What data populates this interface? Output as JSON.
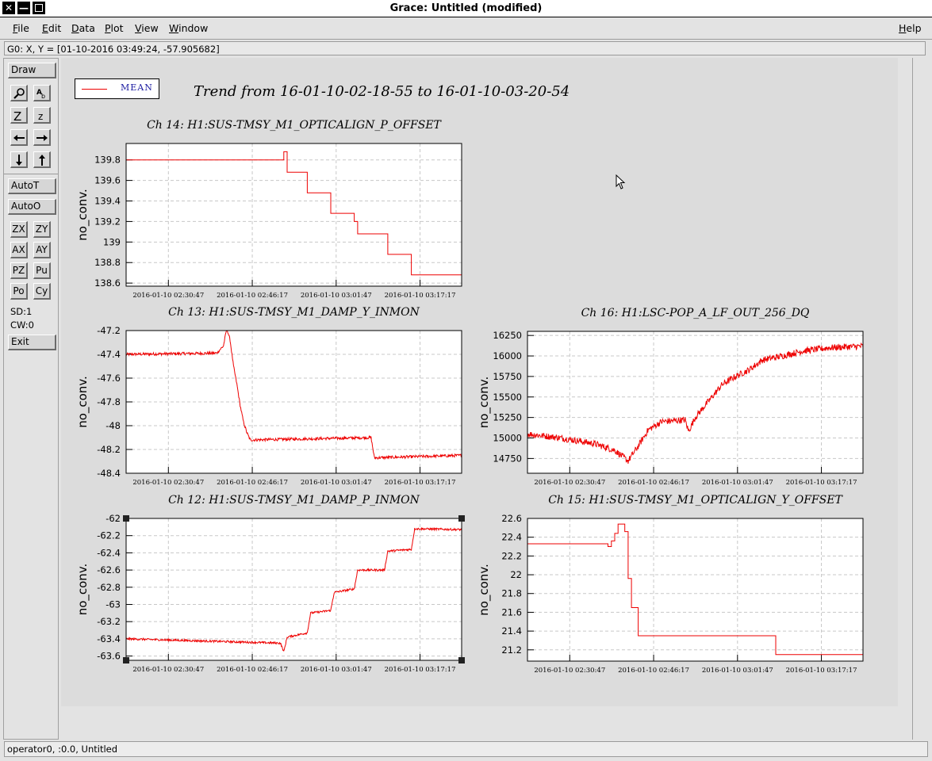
{
  "window": {
    "title": "Grace: Untitled (modified)"
  },
  "menu": [
    "File",
    "Edit",
    "Data",
    "Plot",
    "View",
    "Window"
  ],
  "help_label": "Help",
  "locator_text": "G0: X, Y = [01-10-2016 03:49:24, -57.905682]",
  "toolbar": {
    "draw_label": "Draw",
    "autot_label": "AutoT",
    "autoo_label": "AutoO",
    "zx": "ZX",
    "zy": "ZY",
    "ax": "AX",
    "ay": "AY",
    "pz": "PZ",
    "pu": "Pu",
    "po": "Po",
    "cy": "Cy",
    "sd_label": "SD:1",
    "cw_label": "CW:0",
    "exit_label": "Exit",
    "icons": [
      "zoom-icon",
      "text-icon",
      "zoom-x-icon",
      "zoom-y-icon",
      "left-arrow-icon",
      "right-arrow-icon",
      "down-arrow-icon",
      "up-arrow-icon"
    ]
  },
  "legend": {
    "label": "MEAN",
    "color": "#ee0000"
  },
  "main_title": "Trend from 16-01-10-02-18-55 to 16-01-10-03-20-54",
  "status_text": "operator0, :0.0, Untitled",
  "chart_data": [
    {
      "type": "line",
      "title": "Ch 14: H1:SUS-TMSY_M1_OPTICALIGN_P_OFFSET",
      "ylabel": "no_conv.",
      "xticks": [
        "2016-01-10 02:30:47",
        "2016-01-10 02:46:17",
        "2016-01-10 03:01:47",
        "2016-01-10 03:17:17"
      ],
      "yticks": [
        "139.8",
        "139.6",
        "139.4",
        "139.2",
        "139",
        "138.8",
        "138.6"
      ],
      "ylim": [
        138.57,
        139.96
      ],
      "grid": true,
      "step": true,
      "points": [
        [
          0,
          139.8
        ],
        [
          0.47,
          139.8
        ],
        [
          0.47,
          139.88
        ],
        [
          0.48,
          139.88
        ],
        [
          0.48,
          139.68
        ],
        [
          0.54,
          139.68
        ],
        [
          0.54,
          139.48
        ],
        [
          0.61,
          139.48
        ],
        [
          0.61,
          139.28
        ],
        [
          0.68,
          139.28
        ],
        [
          0.68,
          139.2
        ],
        [
          0.69,
          139.2
        ],
        [
          0.69,
          139.08
        ],
        [
          0.78,
          139.08
        ],
        [
          0.78,
          138.88
        ],
        [
          0.85,
          138.88
        ],
        [
          0.85,
          138.68
        ],
        [
          1.0,
          138.68
        ]
      ],
      "series": [
        {
          "name": "MEAN",
          "color": "#ee0000"
        }
      ]
    },
    {
      "type": "line",
      "title": "Ch 13: H1:SUS-TMSY_M1_DAMP_Y_INMON",
      "ylabel": "no_conv.",
      "xticks": [
        "2016-01-10 02:30:47",
        "2016-01-10 02:46:17",
        "2016-01-10 03:01:47",
        "2016-01-10 03:17:17"
      ],
      "yticks": [
        "-47.2",
        "-47.4",
        "-47.6",
        "-47.8",
        "-48",
        "-48.2",
        "-48.4"
      ],
      "ylim": [
        -48.4,
        -47.2
      ],
      "grid": true,
      "noise": 0.012,
      "points": [
        [
          0,
          -47.4
        ],
        [
          0.27,
          -47.39
        ],
        [
          0.29,
          -47.33
        ],
        [
          0.3,
          -47.18
        ],
        [
          0.31,
          -47.28
        ],
        [
          0.32,
          -47.5
        ],
        [
          0.33,
          -47.65
        ],
        [
          0.34,
          -47.83
        ],
        [
          0.35,
          -47.97
        ],
        [
          0.36,
          -48.06
        ],
        [
          0.37,
          -48.12
        ],
        [
          0.73,
          -48.1
        ],
        [
          0.74,
          -48.27
        ],
        [
          1.0,
          -48.25
        ]
      ],
      "series": [
        {
          "name": "MEAN",
          "color": "#ee0000"
        }
      ]
    },
    {
      "type": "line",
      "title": "Ch 16: H1:LSC-POP_A_LF_OUT_256_DQ",
      "ylabel": "no_conv.",
      "xticks": [
        "2016-01-10 02:30:47",
        "2016-01-10 02:46:17",
        "2016-01-10 03:01:47",
        "2016-01-10 03:17:17"
      ],
      "yticks": [
        "16250",
        "16000",
        "15750",
        "15500",
        "15250",
        "15000",
        "14750"
      ],
      "ylim": [
        14570,
        16300
      ],
      "grid": true,
      "noise": 40,
      "points": [
        [
          0,
          15050
        ],
        [
          0.1,
          15000
        ],
        [
          0.2,
          14930
        ],
        [
          0.26,
          14850
        ],
        [
          0.3,
          14720
        ],
        [
          0.33,
          14900
        ],
        [
          0.36,
          15100
        ],
        [
          0.4,
          15200
        ],
        [
          0.47,
          15220
        ],
        [
          0.48,
          15080
        ],
        [
          0.5,
          15250
        ],
        [
          0.52,
          15350
        ],
        [
          0.55,
          15500
        ],
        [
          0.58,
          15650
        ],
        [
          0.62,
          15750
        ],
        [
          0.66,
          15830
        ],
        [
          0.7,
          15950
        ],
        [
          0.76,
          16000
        ],
        [
          0.82,
          16060
        ],
        [
          0.9,
          16100
        ],
        [
          1.0,
          16120
        ]
      ],
      "series": [
        {
          "name": "MEAN",
          "color": "#ee0000"
        }
      ]
    },
    {
      "type": "line",
      "title": "Ch 12: H1:SUS-TMSY_M1_DAMP_P_INMON",
      "ylabel": "no_conv.",
      "xticks": [
        "2016-01-10 02:30:47",
        "2016-01-10 02:46:17",
        "2016-01-10 03:01:47",
        "2016-01-10 03:17:17"
      ],
      "yticks": [
        "-62",
        "-62.2",
        "-62.4",
        "-62.6",
        "-62.8",
        "-63",
        "-63.2",
        "-63.4",
        "-63.6"
      ],
      "ylim": [
        -63.65,
        -62
      ],
      "grid": true,
      "noise": 0.012,
      "points": [
        [
          0,
          -63.4
        ],
        [
          0.46,
          -63.45
        ],
        [
          0.47,
          -63.55
        ],
        [
          0.48,
          -63.38
        ],
        [
          0.54,
          -63.33
        ],
        [
          0.55,
          -63.1
        ],
        [
          0.61,
          -63.07
        ],
        [
          0.62,
          -62.86
        ],
        [
          0.68,
          -62.82
        ],
        [
          0.69,
          -62.6
        ],
        [
          0.77,
          -62.6
        ],
        [
          0.78,
          -62.38
        ],
        [
          0.85,
          -62.36
        ],
        [
          0.86,
          -62.12
        ],
        [
          1.0,
          -62.13
        ]
      ],
      "series": [
        {
          "name": "MEAN",
          "color": "#ee0000"
        }
      ]
    },
    {
      "type": "line",
      "title": "Ch 15: H1:SUS-TMSY_M1_OPTICALIGN_Y_OFFSET",
      "ylabel": "no_conv.",
      "xticks": [
        "2016-01-10 02:30:47",
        "2016-01-10 02:46:17",
        "2016-01-10 03:01:47",
        "2016-01-10 03:17:17"
      ],
      "yticks": [
        "22.6",
        "22.4",
        "22.2",
        "22",
        "21.8",
        "21.6",
        "21.4",
        "21.2"
      ],
      "ylim": [
        21.08,
        22.6
      ],
      "grid": true,
      "step": true,
      "points": [
        [
          0,
          22.33
        ],
        [
          0.24,
          22.33
        ],
        [
          0.24,
          22.3
        ],
        [
          0.25,
          22.3
        ],
        [
          0.25,
          22.36
        ],
        [
          0.26,
          22.36
        ],
        [
          0.26,
          22.44
        ],
        [
          0.27,
          22.44
        ],
        [
          0.27,
          22.54
        ],
        [
          0.29,
          22.54
        ],
        [
          0.29,
          22.46
        ],
        [
          0.3,
          22.46
        ],
        [
          0.3,
          21.96
        ],
        [
          0.31,
          21.96
        ],
        [
          0.31,
          21.65
        ],
        [
          0.33,
          21.65
        ],
        [
          0.33,
          21.35
        ],
        [
          0.74,
          21.35
        ],
        [
          0.74,
          21.15
        ],
        [
          1.0,
          21.15
        ]
      ],
      "series": [
        {
          "name": "MEAN",
          "color": "#ee0000"
        }
      ]
    }
  ]
}
